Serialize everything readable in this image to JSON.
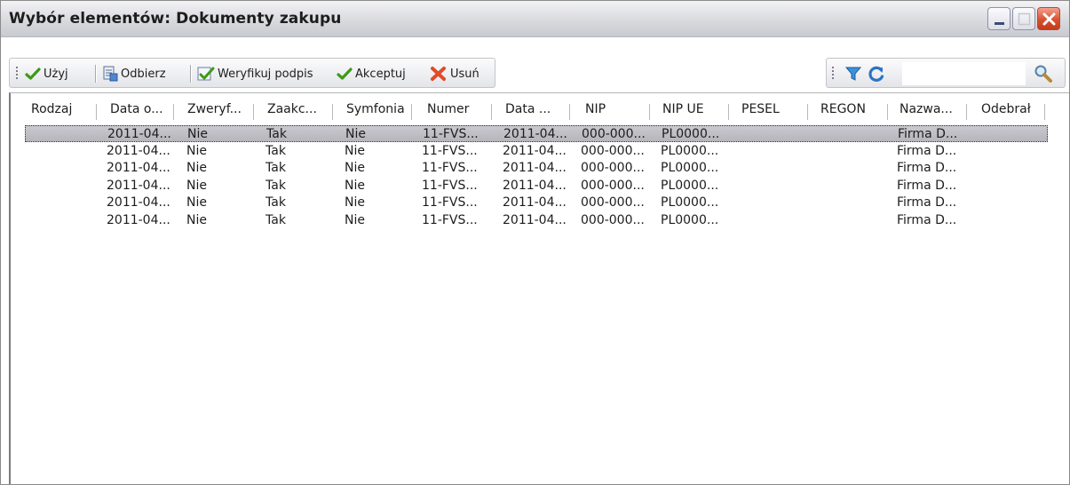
{
  "window": {
    "title": "Wybór elementów: Dokumenty zakupu"
  },
  "toolbar": {
    "items": [
      {
        "label": "Użyj",
        "icon": "check-icon"
      },
      {
        "label": "Odbierz",
        "icon": "receive-document-icon"
      },
      {
        "label": "Weryfikuj podpis",
        "icon": "verify-signature-icon"
      },
      {
        "label": "Akceptuj",
        "icon": "check-icon"
      },
      {
        "label": "Usuń",
        "icon": "delete-x-icon"
      }
    ]
  },
  "filterbar": {
    "filter_icon": "filter-funnel-icon",
    "refresh_icon": "refresh-icon",
    "search_value": "",
    "search_icon": "magnifier-icon"
  },
  "grid": {
    "columns": [
      "Rodzaj",
      "Data o...",
      "Zweryf...",
      "Zaakc...",
      "Symfonia",
      "Numer",
      "Data ...",
      "NIP",
      "NIP UE",
      "PESEL",
      "REGON",
      "Nazwa...",
      "Odebrał"
    ],
    "rows": [
      [
        "",
        "2011-04...",
        "Nie",
        "Tak",
        "Nie",
        "11-FVS...",
        "2011-04...",
        "000-000...",
        "PL0000...",
        "",
        "",
        "Firma D...",
        ""
      ],
      [
        "",
        "2011-04...",
        "Nie",
        "Tak",
        "Nie",
        "11-FVS...",
        "2011-04...",
        "000-000...",
        "PL0000...",
        "",
        "",
        "Firma D...",
        ""
      ],
      [
        "",
        "2011-04...",
        "Nie",
        "Tak",
        "Nie",
        "11-FVS...",
        "2011-04...",
        "000-000...",
        "PL0000...",
        "",
        "",
        "Firma D...",
        ""
      ],
      [
        "",
        "2011-04...",
        "Nie",
        "Tak",
        "Nie",
        "11-FVS...",
        "2011-04...",
        "000-000...",
        "PL0000...",
        "",
        "",
        "Firma D...",
        ""
      ],
      [
        "",
        "2011-04...",
        "Nie",
        "Tak",
        "Nie",
        "11-FVS...",
        "2011-04...",
        "000-000...",
        "PL0000...",
        "",
        "",
        "Firma D...",
        ""
      ],
      [
        "",
        "2011-04...",
        "Nie",
        "Tak",
        "Nie",
        "11-FVS...",
        "2011-04...",
        "000-000...",
        "PL0000...",
        "",
        "",
        "Firma D...",
        ""
      ]
    ],
    "selected_row": 0
  }
}
